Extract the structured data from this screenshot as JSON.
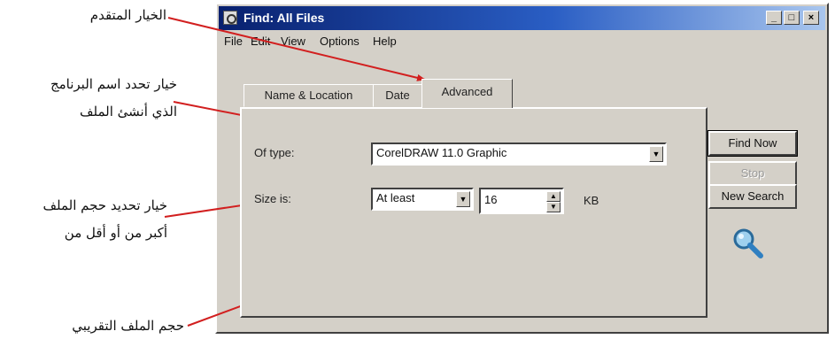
{
  "annotations": {
    "advanced_option": "الخيار المتقدم",
    "program_option_line1": "خيار تحدد اسم البرنامج",
    "program_option_line2": "الذي أنشئ الملف",
    "size_option_line1": "خيار تحديد حجم الملف",
    "size_option_line2": "أكبر من أو أقل من",
    "approx_size": "حجم الملف التقريبي",
    "arrow_color": "#d21f1f"
  },
  "window": {
    "title": "Find: All Files",
    "minimize": "_",
    "maximize": "□",
    "close": "×",
    "title_bar_color": "#08206e"
  },
  "menu": [
    "File",
    "Edit",
    "View",
    "Options",
    "Help"
  ],
  "tabs": [
    "Name & Location",
    "Date",
    "Advanced"
  ],
  "active_tab": "Advanced",
  "form": {
    "of_type_label": "Of type:",
    "of_type_value": "CorelDRAW 11.0 Graphic",
    "size_label": "Size is:",
    "size_mode_value": "At least",
    "size_value": "16",
    "size_unit": "KB",
    "dropdown_arrow": "▼",
    "spin_up": "▲",
    "spin_down": "▼"
  },
  "buttons": {
    "find_now": "Find Now",
    "stop": "Stop",
    "new_search": "New Search"
  },
  "icons": {
    "magnifier": "magnifier-icon"
  }
}
